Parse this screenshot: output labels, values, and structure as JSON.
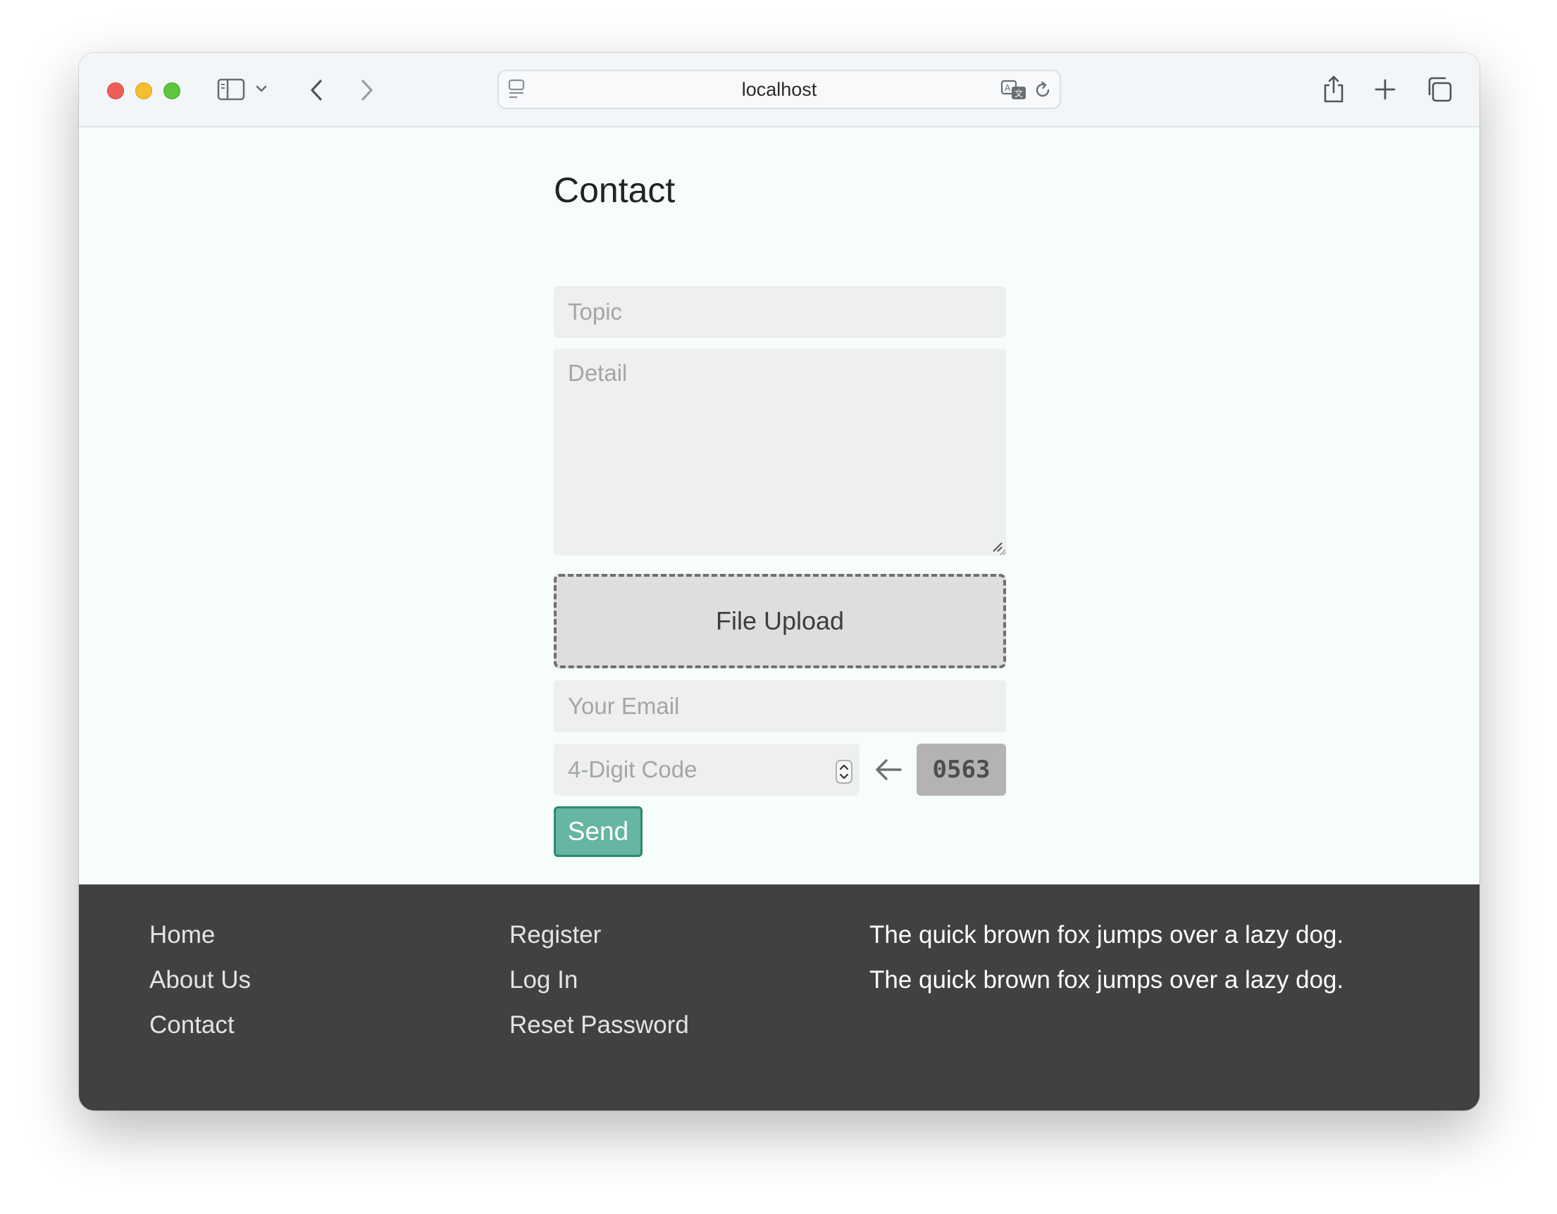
{
  "browser": {
    "url": "localhost"
  },
  "form": {
    "title": "Contact",
    "topic_placeholder": "Topic",
    "detail_placeholder": "Detail",
    "file_upload_label": "File Upload",
    "email_placeholder": "Your Email",
    "code_placeholder": "4-Digit Code",
    "captcha_code": "0563",
    "send_label": "Send"
  },
  "footer": {
    "col1": [
      "Home",
      "About Us",
      "Contact"
    ],
    "col2": [
      "Register",
      "Log In",
      "Reset Password"
    ],
    "col3": [
      "The quick brown fox jumps over a lazy dog.",
      "The quick brown fox jumps over a lazy dog."
    ]
  },
  "colors": {
    "page_background": "#f7fdfb",
    "footer_background": "#404141",
    "send_button": "#67b5a3",
    "send_border": "#2c8a6e",
    "captcha_background": "#b3b3b3"
  }
}
